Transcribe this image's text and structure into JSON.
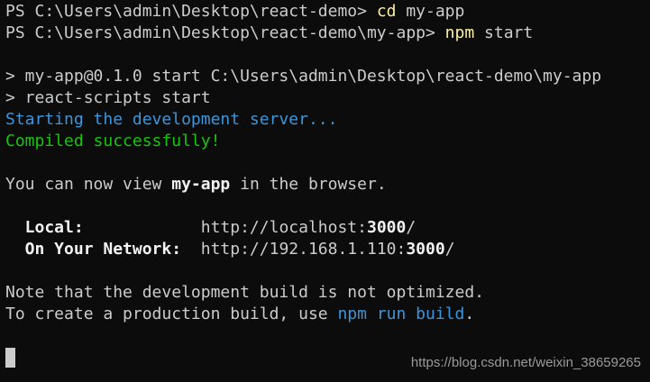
{
  "lines": {
    "l1": {
      "prompt": "PS C:\\Users\\admin\\Desktop\\react-demo> ",
      "cmd": "cd",
      "args": " my-app"
    },
    "l2": {
      "prompt": "PS C:\\Users\\admin\\Desktop\\react-demo\\my-app> ",
      "cmd": "npm",
      "args": " start"
    },
    "l3": "> my-app@0.1.0 start C:\\Users\\admin\\Desktop\\react-demo\\my-app",
    "l4": "> react-scripts start",
    "l5": "Starting the development server...",
    "l6": "Compiled successfully!",
    "l7": {
      "pre": "You can now view ",
      "app": "my-app",
      "post": " in the browser."
    },
    "l8": {
      "label": "  Local:            ",
      "url_pre": "http://localhost:",
      "port": "3000",
      "url_post": "/"
    },
    "l9": {
      "label": "  On Your Network:  ",
      "url_pre": "http://192.168.1.110:",
      "port": "3000",
      "url_post": "/"
    },
    "l10": "Note that the development build is not optimized.",
    "l11": {
      "pre": "To create a production build, use ",
      "cmd": "npm run build",
      "post": "."
    }
  },
  "watermark": "https://blog.csdn.net/weixin_38659265",
  "colors": {
    "background": "#0c0c0c",
    "text": "#cccccc",
    "command": "#f9f1a5",
    "info": "#3a96dd",
    "success": "#16c60c"
  }
}
